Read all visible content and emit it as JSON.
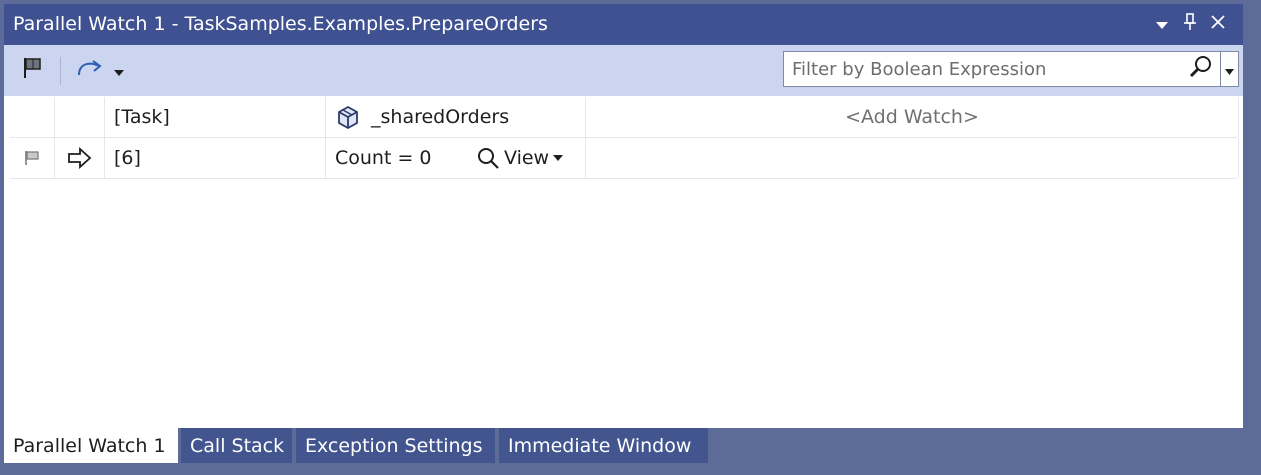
{
  "window": {
    "title": "Parallel Watch 1 - TaskSamples.Examples.PrepareOrders",
    "buttons": [
      "dropdown-icon",
      "pin-icon",
      "close-icon"
    ]
  },
  "toolbar": {
    "flag_tool": "flag-icon",
    "switch_tool": "switch-thread-icon",
    "filter": {
      "placeholder": "Filter by Boolean Expression",
      "value": ""
    }
  },
  "grid": {
    "columns": [
      "",
      "",
      "[Task]",
      "_sharedOrders",
      "<Add Watch>"
    ],
    "rows": [
      {
        "flag": "flag-icon",
        "current": "arrow-right-icon",
        "task": "[6]",
        "shared_orders": "Count = 0",
        "view_label": "View"
      }
    ]
  },
  "tabs": [
    "Parallel Watch 1",
    "Call Stack",
    "Exception Settings",
    "Immediate Window"
  ],
  "colors": {
    "chrome": "#5d6b99",
    "titlebar": "#3f5190",
    "toolbar": "#ccd5f0",
    "tab": "#42558f",
    "add_watch": "#707070"
  }
}
